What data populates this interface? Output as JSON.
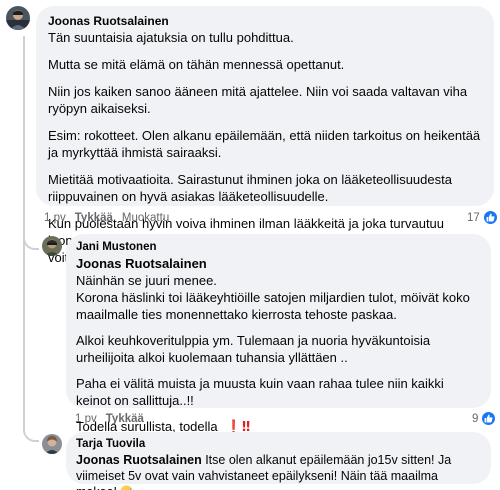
{
  "comments": [
    {
      "author": "Joonas Ruotsalainen",
      "paragraphs": [
        "Tän suuntaisia ajatuksia on tullu pohdittua.",
        "Mutta se mitä elämä on tähän mennessä opettanut.",
        "Niin jos kaiken sanoo ääneen mitä ajattelee. Niin voi saada valtavan viha ryöpyn aikaiseksi.",
        "Esim: rokotteet. Olen alkanu epäilemään, että niiden tarkoitus on heikentää ja myrkyttää ihmistä sairaaksi.",
        "Mietitää motivaatioita. Sairastunut ihminen joka on lääketeollisuudesta riippuvainen on hyvä asiakas lääketeollisuudelle.",
        "Kun puolestaan hyvin voiva ihminen ilman lääkkeitä ja joka turvautuu luonnon rohtoihin. Mihin lääketeollisuus ei pääse käsiksi väliin tahkomaan voittoja."
      ],
      "time": "1 pv",
      "like_label": "Tykkää",
      "edited_label": "Muokattu",
      "reaction_count": "17"
    },
    {
      "author": "Jani Mustonen",
      "mention": "Joonas Ruotsalainen",
      "first_lines": [
        "Näinhän se juuri menee.",
        "Korona häslinki toi lääkeyhtiöille satojen miljardien tulot, möivät koko maailmalle ties monennettako kierrosta tehoste paskaa."
      ],
      "paragraphs": [
        "Alkoi keuhkoveritulppia ym. Tulemaan ja nuoria hyväkuntoisia urheilijoita alkoi kuolemaan tuhansia yllättäen ..",
        "Paha ei välitä muista ja muusta kuin vaan rahaa tulee niin kaikki keinot on sallittuja..!!"
      ],
      "last_line": "Todella surullista, todella",
      "time": "1 pv",
      "like_label": "Tykkää",
      "reaction_count": "9"
    },
    {
      "author": "Tarja Tuovila",
      "mention": "Joonas Ruotsalainen",
      "text": " Itse olen alkanut epäilemään jo15v sitten! Ja viimeiset 5v ovat vain vahvistaneet epäilykseni! Näin tää maailma makaa!"
    }
  ],
  "icons": {
    "reaction": "like-thumb-icon",
    "exclamations": "red-exclamation-icons",
    "emoji": "downcast-sweat-face-icon"
  },
  "colors": {
    "bubble": "#f0f2f5",
    "like_blue": "#1877f2",
    "meta_gray": "#65676b",
    "exclamation_red": "#e02020"
  }
}
